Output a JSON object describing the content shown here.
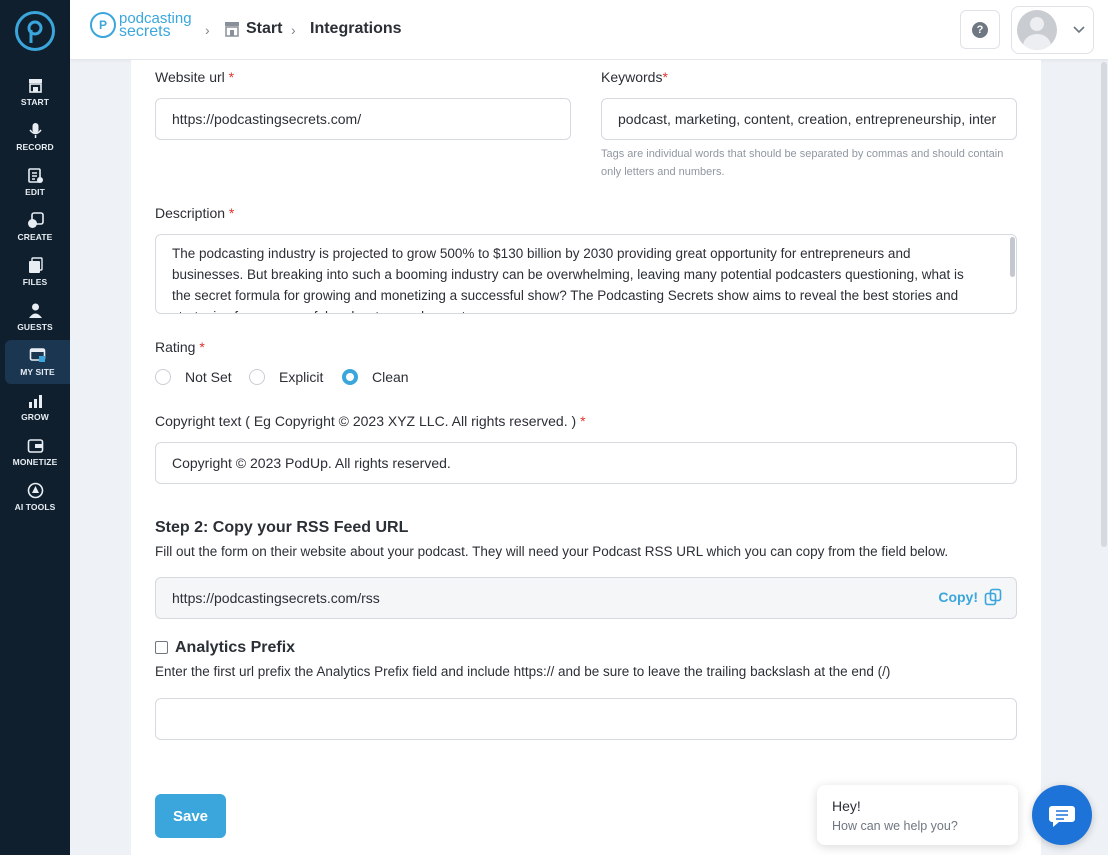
{
  "sidebar": {
    "items": [
      {
        "label": "START",
        "icon": "storefront-icon"
      },
      {
        "label": "RECORD",
        "icon": "microphone-icon"
      },
      {
        "label": "EDIT",
        "icon": "edit-icon"
      },
      {
        "label": "CREATE",
        "icon": "create-icon"
      },
      {
        "label": "FILES",
        "icon": "files-icon"
      },
      {
        "label": "GUESTS",
        "icon": "guests-icon"
      },
      {
        "label": "MY SITE",
        "icon": "my-site-icon",
        "active": true
      },
      {
        "label": "GROW",
        "icon": "grow-chart-icon"
      },
      {
        "label": "MONETIZE",
        "icon": "monetize-icon"
      },
      {
        "label": "AI TOOLS",
        "icon": "ai-tools-icon"
      }
    ]
  },
  "header": {
    "brand_line1": "podcasting",
    "brand_line2": "secrets",
    "breadcrumb": [
      "Start",
      "Integrations"
    ],
    "help_icon": "question-icon"
  },
  "form": {
    "website_url_label": "Website url",
    "website_url_value": "https://podcastingsecrets.com/",
    "keywords_label": "Keywords",
    "keywords_value": "podcast, marketing, content, creation, entrepreneurship, inter",
    "keywords_hint": "Tags are individual words that should be separated by commas and should contain only letters and numbers.",
    "description_label": "Description",
    "description_value": "The podcasting industry is projected to grow 500% to $130 billion by 2030 providing great opportunity for entrepreneurs and businesses. But breaking into such a booming industry can be overwhelming, leaving many potential podcasters questioning, what is the secret formula for growing and monetizing a successful show? The Podcasting Secrets show aims to reveal the best stories and strategies from successful podcasters and experts",
    "rating_label": "Rating",
    "rating_options": [
      "Not Set",
      "Explicit",
      "Clean"
    ],
    "rating_selected": "Clean",
    "copyright_label": "Copyright text ( Eg Copyright © 2023 XYZ LLC. All rights reserved. )",
    "copyright_value": "Copyright © 2023 PodUp. All rights reserved."
  },
  "step2": {
    "title": "Step 2: Copy your RSS Feed URL",
    "instructions": "Fill out the form on their website about your podcast. They will need your Podcast RSS URL which you can copy from the field below.",
    "rss_url": "https://podcastingsecrets.com/rss",
    "copy_label": "Copy!"
  },
  "analytics": {
    "label": "Analytics Prefix",
    "checked": false,
    "instructions": "Enter the first url prefix the Analytics Prefix field and include https:// and be sure to leave the trailing backslash at the end (/)",
    "value": ""
  },
  "actions": {
    "save_label": "Save"
  },
  "chat": {
    "greeting": "Hey!",
    "prompt": "How can we help you?"
  },
  "colors": {
    "accent": "#3aa6dc",
    "sidebar_bg": "#0f1f2e",
    "required": "#e0342e",
    "chat": "#1e73d8"
  }
}
